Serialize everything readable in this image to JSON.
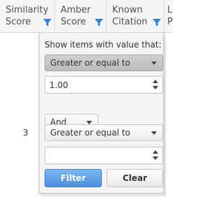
{
  "columns": [
    {
      "label": "Similarity\nScore"
    },
    {
      "label": "Amber\nScore"
    },
    {
      "label": "Known\nCitation"
    },
    {
      "label": "L\nP"
    }
  ],
  "row_value": "3",
  "filter_popup": {
    "title": "Show items with value that:",
    "condition1": "Greater or equal to",
    "value1": "1.00",
    "logic": "And",
    "condition2": "Greater or equal to",
    "value2": "",
    "filter_label": "Filter",
    "clear_label": "Clear"
  },
  "colors": {
    "filter_icon": "#2f80d6",
    "primary_button": "#4a8fdc"
  }
}
